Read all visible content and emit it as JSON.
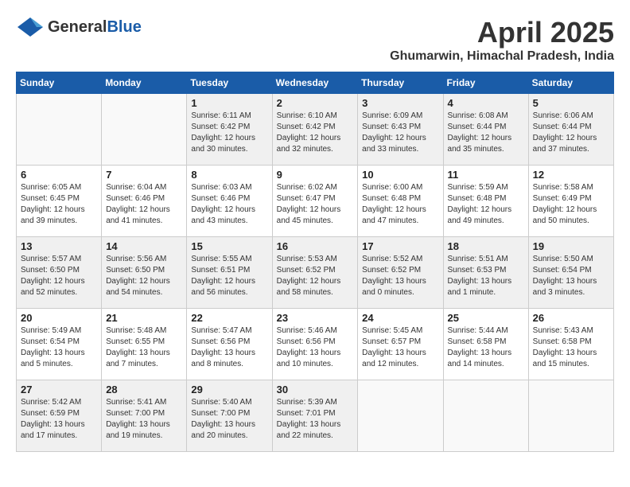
{
  "header": {
    "logo_general": "General",
    "logo_blue": "Blue",
    "month_title": "April 2025",
    "location": "Ghumarwin, Himachal Pradesh, India"
  },
  "days_of_week": [
    "Sunday",
    "Monday",
    "Tuesday",
    "Wednesday",
    "Thursday",
    "Friday",
    "Saturday"
  ],
  "weeks": [
    [
      {
        "day": "",
        "info": ""
      },
      {
        "day": "",
        "info": ""
      },
      {
        "day": "1",
        "info": "Sunrise: 6:11 AM\nSunset: 6:42 PM\nDaylight: 12 hours\nand 30 minutes."
      },
      {
        "day": "2",
        "info": "Sunrise: 6:10 AM\nSunset: 6:42 PM\nDaylight: 12 hours\nand 32 minutes."
      },
      {
        "day": "3",
        "info": "Sunrise: 6:09 AM\nSunset: 6:43 PM\nDaylight: 12 hours\nand 33 minutes."
      },
      {
        "day": "4",
        "info": "Sunrise: 6:08 AM\nSunset: 6:44 PM\nDaylight: 12 hours\nand 35 minutes."
      },
      {
        "day": "5",
        "info": "Sunrise: 6:06 AM\nSunset: 6:44 PM\nDaylight: 12 hours\nand 37 minutes."
      }
    ],
    [
      {
        "day": "6",
        "info": "Sunrise: 6:05 AM\nSunset: 6:45 PM\nDaylight: 12 hours\nand 39 minutes."
      },
      {
        "day": "7",
        "info": "Sunrise: 6:04 AM\nSunset: 6:46 PM\nDaylight: 12 hours\nand 41 minutes."
      },
      {
        "day": "8",
        "info": "Sunrise: 6:03 AM\nSunset: 6:46 PM\nDaylight: 12 hours\nand 43 minutes."
      },
      {
        "day": "9",
        "info": "Sunrise: 6:02 AM\nSunset: 6:47 PM\nDaylight: 12 hours\nand 45 minutes."
      },
      {
        "day": "10",
        "info": "Sunrise: 6:00 AM\nSunset: 6:48 PM\nDaylight: 12 hours\nand 47 minutes."
      },
      {
        "day": "11",
        "info": "Sunrise: 5:59 AM\nSunset: 6:48 PM\nDaylight: 12 hours\nand 49 minutes."
      },
      {
        "day": "12",
        "info": "Sunrise: 5:58 AM\nSunset: 6:49 PM\nDaylight: 12 hours\nand 50 minutes."
      }
    ],
    [
      {
        "day": "13",
        "info": "Sunrise: 5:57 AM\nSunset: 6:50 PM\nDaylight: 12 hours\nand 52 minutes."
      },
      {
        "day": "14",
        "info": "Sunrise: 5:56 AM\nSunset: 6:50 PM\nDaylight: 12 hours\nand 54 minutes."
      },
      {
        "day": "15",
        "info": "Sunrise: 5:55 AM\nSunset: 6:51 PM\nDaylight: 12 hours\nand 56 minutes."
      },
      {
        "day": "16",
        "info": "Sunrise: 5:53 AM\nSunset: 6:52 PM\nDaylight: 12 hours\nand 58 minutes."
      },
      {
        "day": "17",
        "info": "Sunrise: 5:52 AM\nSunset: 6:52 PM\nDaylight: 13 hours\nand 0 minutes."
      },
      {
        "day": "18",
        "info": "Sunrise: 5:51 AM\nSunset: 6:53 PM\nDaylight: 13 hours\nand 1 minute."
      },
      {
        "day": "19",
        "info": "Sunrise: 5:50 AM\nSunset: 6:54 PM\nDaylight: 13 hours\nand 3 minutes."
      }
    ],
    [
      {
        "day": "20",
        "info": "Sunrise: 5:49 AM\nSunset: 6:54 PM\nDaylight: 13 hours\nand 5 minutes."
      },
      {
        "day": "21",
        "info": "Sunrise: 5:48 AM\nSunset: 6:55 PM\nDaylight: 13 hours\nand 7 minutes."
      },
      {
        "day": "22",
        "info": "Sunrise: 5:47 AM\nSunset: 6:56 PM\nDaylight: 13 hours\nand 8 minutes."
      },
      {
        "day": "23",
        "info": "Sunrise: 5:46 AM\nSunset: 6:56 PM\nDaylight: 13 hours\nand 10 minutes."
      },
      {
        "day": "24",
        "info": "Sunrise: 5:45 AM\nSunset: 6:57 PM\nDaylight: 13 hours\nand 12 minutes."
      },
      {
        "day": "25",
        "info": "Sunrise: 5:44 AM\nSunset: 6:58 PM\nDaylight: 13 hours\nand 14 minutes."
      },
      {
        "day": "26",
        "info": "Sunrise: 5:43 AM\nSunset: 6:58 PM\nDaylight: 13 hours\nand 15 minutes."
      }
    ],
    [
      {
        "day": "27",
        "info": "Sunrise: 5:42 AM\nSunset: 6:59 PM\nDaylight: 13 hours\nand 17 minutes."
      },
      {
        "day": "28",
        "info": "Sunrise: 5:41 AM\nSunset: 7:00 PM\nDaylight: 13 hours\nand 19 minutes."
      },
      {
        "day": "29",
        "info": "Sunrise: 5:40 AM\nSunset: 7:00 PM\nDaylight: 13 hours\nand 20 minutes."
      },
      {
        "day": "30",
        "info": "Sunrise: 5:39 AM\nSunset: 7:01 PM\nDaylight: 13 hours\nand 22 minutes."
      },
      {
        "day": "",
        "info": ""
      },
      {
        "day": "",
        "info": ""
      },
      {
        "day": "",
        "info": ""
      }
    ]
  ]
}
